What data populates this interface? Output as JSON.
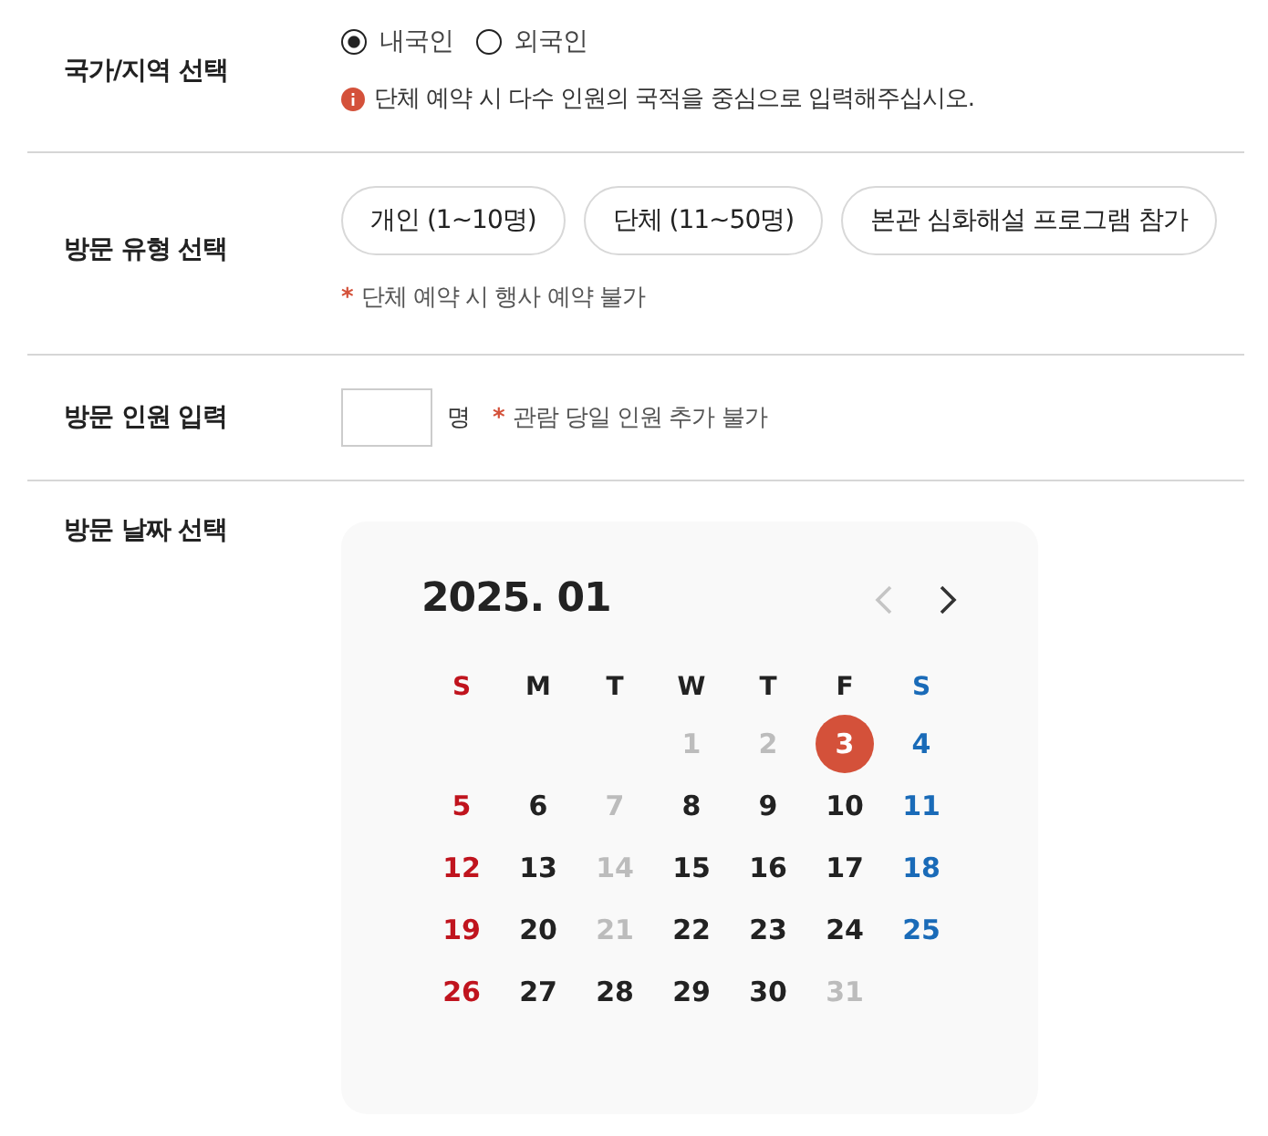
{
  "nationality": {
    "label": "국가/지역 선택",
    "options": [
      {
        "label": "내국인",
        "selected": true
      },
      {
        "label": "외국인",
        "selected": false
      }
    ],
    "notice": "단체 예약 시 다수 인원의 국적을 중심으로 입력해주십시오."
  },
  "visit_type": {
    "label": "방문 유형 선택",
    "options": [
      {
        "label": "개인 (1~10명)",
        "selected": false
      },
      {
        "label": "단체 (11~50명)",
        "selected": false
      },
      {
        "label": "본관 심화해설 프로그램 참가",
        "selected": false
      }
    ],
    "note_mark": "*",
    "note": "단체 예약 시 행사 예약 불가"
  },
  "visitors": {
    "label": "방문 인원 입력",
    "unit": "명",
    "note_mark": "*",
    "note": "관람 당일 인원 추가 불가"
  },
  "visit_date": {
    "label": "방문 날짜 선택",
    "calendar": {
      "month": "2025. 01",
      "prev_disabled": true,
      "next_disabled": false,
      "weekdays": [
        "S",
        "M",
        "T",
        "W",
        "T",
        "F",
        "S"
      ],
      "weeks": [
        [
          {
            "kind": "blank"
          },
          {
            "kind": "blank"
          },
          {
            "kind": "blank"
          },
          {
            "kind": "day",
            "day": "1",
            "disabled": true,
            "selected": false
          },
          {
            "day": "2",
            "disabled": true,
            "selected": false
          },
          {
            "day": "3",
            "disabled": false,
            "selected": true
          },
          {
            "day": "4",
            "disabled": false,
            "selected": false
          }
        ],
        [
          {
            "day": "5",
            "disabled": false,
            "selected": false
          },
          {
            "day": "6",
            "disabled": false,
            "selected": false
          },
          {
            "day": "7",
            "disabled": true,
            "selected": false
          },
          {
            "day": "8",
            "disabled": false,
            "selected": false
          },
          {
            "day": "9",
            "disabled": false,
            "selected": false
          },
          {
            "day": "10",
            "disabled": false,
            "selected": false
          },
          {
            "day": "11",
            "disabled": false,
            "selected": false
          }
        ],
        [
          {
            "day": "12",
            "disabled": false,
            "selected": false
          },
          {
            "day": "13",
            "disabled": false,
            "selected": false
          },
          {
            "day": "14",
            "disabled": true,
            "selected": false
          },
          {
            "day": "15",
            "disabled": false,
            "selected": false
          },
          {
            "day": "16",
            "disabled": false,
            "selected": false
          },
          {
            "day": "17",
            "disabled": false,
            "selected": false
          },
          {
            "day": "18",
            "disabled": false,
            "selected": false
          }
        ],
        [
          {
            "day": "19",
            "disabled": false,
            "selected": false
          },
          {
            "day": "20",
            "disabled": false,
            "selected": false
          },
          {
            "day": "21",
            "disabled": true,
            "selected": false
          },
          {
            "day": "22",
            "disabled": false,
            "selected": false
          },
          {
            "day": "23",
            "disabled": false,
            "selected": false
          },
          {
            "day": "24",
            "disabled": false,
            "selected": false
          },
          {
            "day": "25",
            "disabled": false,
            "selected": false
          }
        ],
        [
          {
            "day": "26",
            "disabled": false,
            "selected": false
          },
          {
            "day": "27",
            "disabled": false,
            "selected": false
          },
          {
            "day": "28",
            "disabled": false,
            "selected": false
          },
          {
            "day": "29",
            "disabled": false,
            "selected": false
          },
          {
            "day": "30",
            "disabled": false,
            "selected": false
          },
          {
            "day": "31",
            "disabled": true,
            "selected": false
          },
          {
            "kind": "blank"
          }
        ]
      ]
    }
  }
}
